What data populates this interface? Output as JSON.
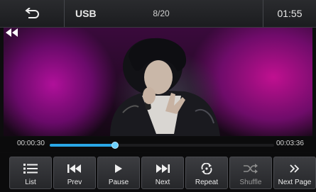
{
  "topbar": {
    "source": "USB",
    "track_counter": "8/20",
    "clock": "01:55"
  },
  "playback": {
    "elapsed": "00:00:30",
    "total": "00:03:36",
    "progress_fraction": 0.29
  },
  "controls": [
    {
      "label": "List",
      "icon": "list-icon"
    },
    {
      "label": "Prev",
      "icon": "previous-icon"
    },
    {
      "label": "Pause",
      "icon": "pause-icon"
    },
    {
      "label": "Next",
      "icon": "next-icon"
    },
    {
      "label": "Repeat",
      "icon": "repeat-icon"
    },
    {
      "label": "Shuffle",
      "icon": "shuffle-icon"
    },
    {
      "label": "Next Page",
      "icon": "chevrons-right-icon"
    }
  ],
  "colors": {
    "accent": "#2aa7e6",
    "background": "#0b0b0c",
    "button": "#333438"
  }
}
